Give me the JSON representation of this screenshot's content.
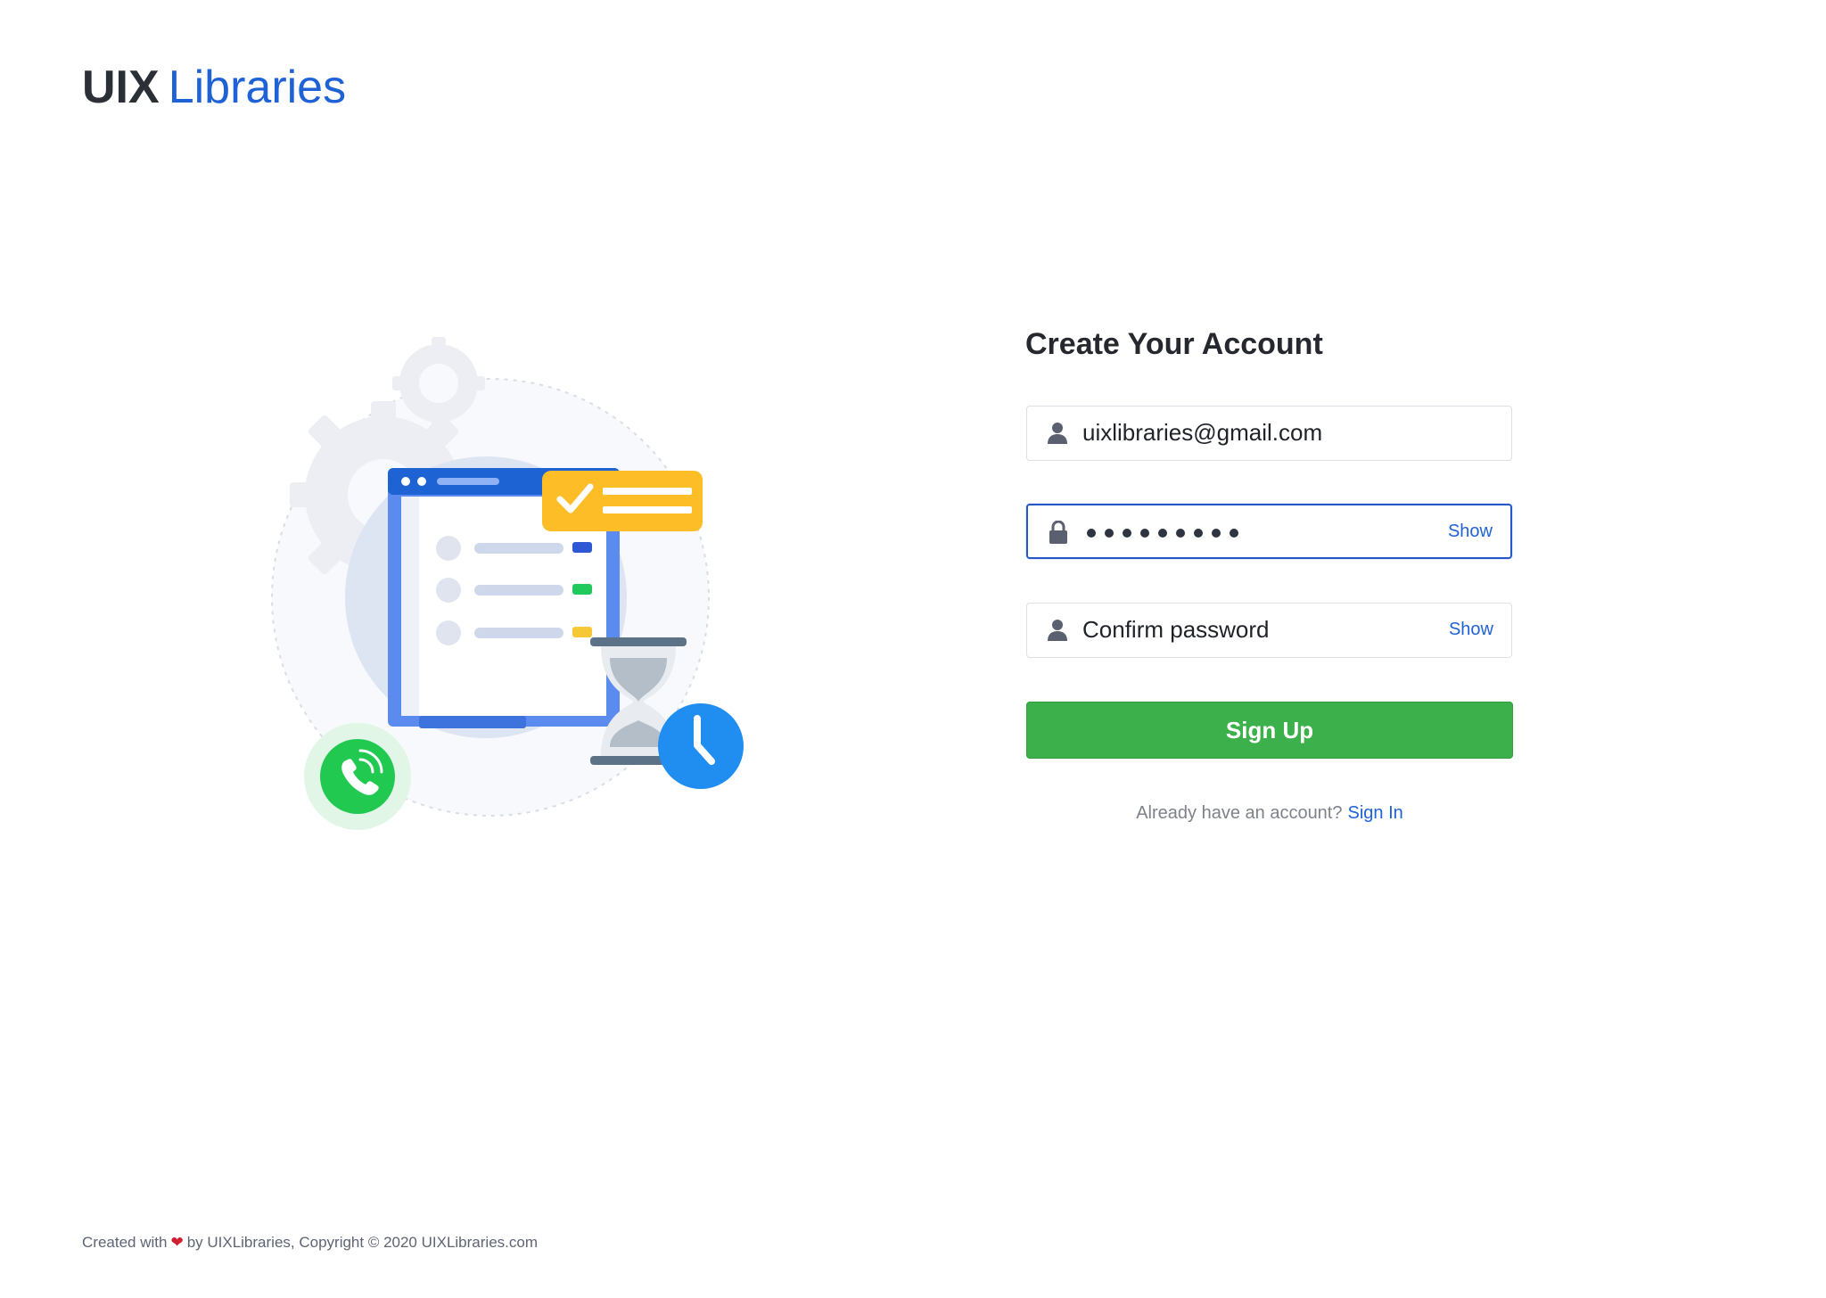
{
  "brand": {
    "logo_primary": "UIX",
    "logo_secondary": "Libraries",
    "accent_color": "#1f62d6"
  },
  "form": {
    "title": "Create Your Account",
    "email": {
      "value": "uixlibraries@gmail.com",
      "icon": "user-icon"
    },
    "password": {
      "masked_length": 9,
      "show_label": "Show",
      "icon": "lock-icon",
      "state": "focused"
    },
    "confirm_password": {
      "placeholder": "Confirm password",
      "show_label": "Show",
      "icon": "user-icon"
    },
    "submit_label": "Sign Up",
    "submit_color": "#3cb04a",
    "signin_prompt": "Already have an account?",
    "signin_link": "Sign In"
  },
  "footer": {
    "prefix": "Created with",
    "heart": "❤",
    "suffix": "by UIXLibraries, Copyright © 2020 UIXLibraries.com"
  }
}
